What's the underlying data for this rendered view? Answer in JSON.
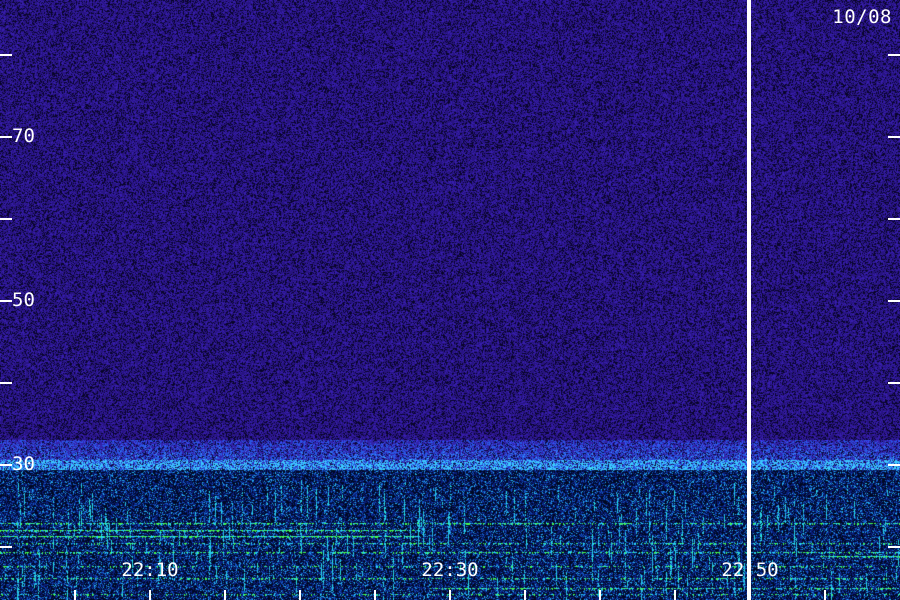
{
  "date": "10/08",
  "y_axis": {
    "labels": [
      "70",
      "50",
      "30"
    ]
  },
  "x_axis": {
    "labels": [
      "22:10",
      "22:30",
      "22:50"
    ]
  },
  "colors": {
    "background_noise": "#2a1478",
    "dark_noise": "#0a0530",
    "band_cyan": "#2ad0ff",
    "band_green": "#40ff40",
    "marker": "#ffffff",
    "text": "#ffffff"
  }
}
